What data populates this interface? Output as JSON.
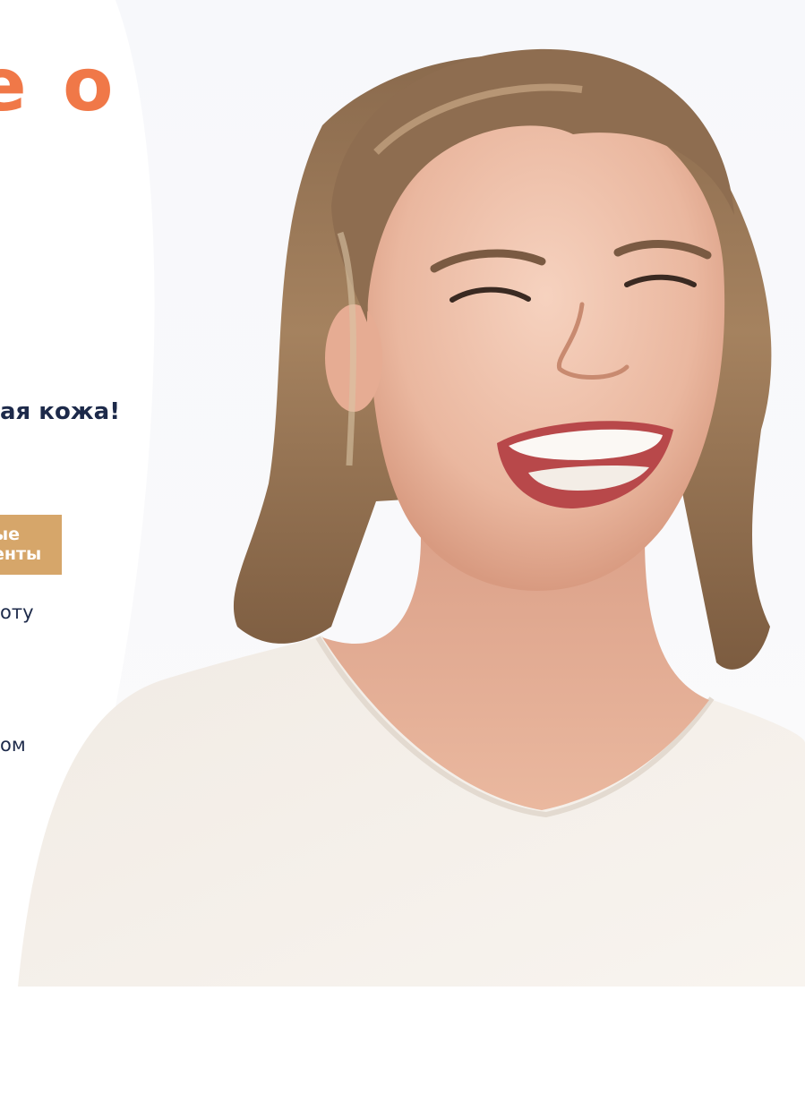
{
  "hero": {
    "headline": "е о",
    "subheadline": "ая кожа!",
    "cta_line1": "ые",
    "cta_line2": "енты",
    "text_1": "оту",
    "text_2": "ом"
  },
  "colors": {
    "accent": "#f07848",
    "button": "#d6a66a",
    "text_dark": "#1d2a4a",
    "shirt": "#f4efea"
  },
  "photo": {
    "icon": "smiling-woman-photo"
  }
}
